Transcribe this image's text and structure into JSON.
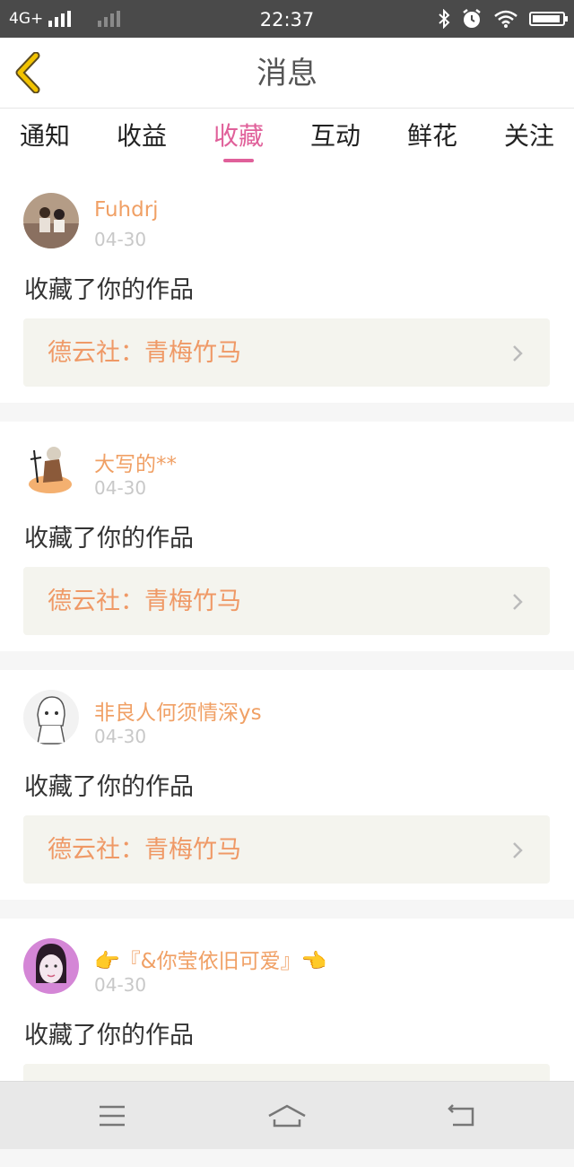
{
  "status_bar": {
    "network": "4G+",
    "time": "22:37",
    "icons": [
      "signal-icon",
      "signal-secondary-icon",
      "bluetooth-icon",
      "alarm-icon",
      "wifi-icon",
      "battery-icon"
    ]
  },
  "header": {
    "title": "消息",
    "back_icon": "chevron-left-icon"
  },
  "tabs": [
    {
      "label": "通知",
      "active": false
    },
    {
      "label": "收益",
      "active": false
    },
    {
      "label": "收藏",
      "active": true
    },
    {
      "label": "互动",
      "active": false
    },
    {
      "label": "鲜花",
      "active": false
    },
    {
      "label": "关注",
      "active": false
    }
  ],
  "notifications": [
    {
      "user": "Fuhdrj",
      "date": "04-30",
      "action": "收藏了你的作品",
      "work": "德云社：青梅竹马"
    },
    {
      "user": "大写的**",
      "date": "04-30",
      "action": "收藏了你的作品",
      "work": "德云社：青梅竹马"
    },
    {
      "user": "非良人何须情深ys",
      "date": "04-30",
      "action": "收藏了你的作品",
      "work": "德云社：青梅竹马"
    },
    {
      "user": "👉『&你莹依旧可爱』👈",
      "date": "04-30",
      "action": "收藏了你的作品",
      "work": ""
    }
  ],
  "colors": {
    "accent": "#e0609a",
    "username": "#f0a065",
    "work_title": "#ef9966",
    "date": "#c8c8c8",
    "back_arrow": "#f2c300"
  },
  "nav_bar": {
    "icons": [
      "menu-icon",
      "home-icon",
      "back-icon"
    ]
  }
}
